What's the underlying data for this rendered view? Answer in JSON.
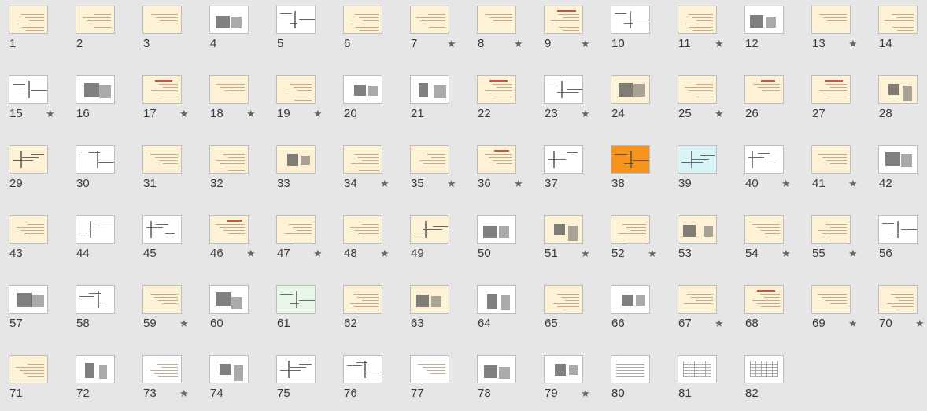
{
  "slides": [
    {
      "n": "1",
      "star": false,
      "bg": "cream",
      "kind": "text"
    },
    {
      "n": "2",
      "star": false,
      "bg": "cream",
      "kind": "text"
    },
    {
      "n": "3",
      "star": false,
      "bg": "cream",
      "kind": "text"
    },
    {
      "n": "4",
      "star": false,
      "bg": "white",
      "kind": "image"
    },
    {
      "n": "5",
      "star": false,
      "bg": "white",
      "kind": "diagram"
    },
    {
      "n": "6",
      "star": false,
      "bg": "cream",
      "kind": "text"
    },
    {
      "n": "7",
      "star": true,
      "bg": "cream",
      "kind": "text"
    },
    {
      "n": "8",
      "star": true,
      "bg": "cream",
      "kind": "text"
    },
    {
      "n": "9",
      "star": true,
      "bg": "cream",
      "kind": "title"
    },
    {
      "n": "10",
      "star": false,
      "bg": "white",
      "kind": "diagram"
    },
    {
      "n": "11",
      "star": true,
      "bg": "cream",
      "kind": "text"
    },
    {
      "n": "12",
      "star": false,
      "bg": "white",
      "kind": "image"
    },
    {
      "n": "13",
      "star": true,
      "bg": "cream",
      "kind": "text"
    },
    {
      "n": "14",
      "star": false,
      "bg": "cream",
      "kind": "text"
    },
    {
      "n": "15",
      "star": true,
      "bg": "white",
      "kind": "diagram"
    },
    {
      "n": "16",
      "star": false,
      "bg": "white",
      "kind": "image"
    },
    {
      "n": "17",
      "star": true,
      "bg": "cream",
      "kind": "title"
    },
    {
      "n": "18",
      "star": true,
      "bg": "cream",
      "kind": "text"
    },
    {
      "n": "19",
      "star": true,
      "bg": "cream",
      "kind": "text"
    },
    {
      "n": "20",
      "star": false,
      "bg": "white",
      "kind": "image"
    },
    {
      "n": "21",
      "star": false,
      "bg": "white",
      "kind": "image"
    },
    {
      "n": "22",
      "star": false,
      "bg": "cream",
      "kind": "title"
    },
    {
      "n": "23",
      "star": true,
      "bg": "white",
      "kind": "diagram"
    },
    {
      "n": "24",
      "star": false,
      "bg": "cream",
      "kind": "image"
    },
    {
      "n": "25",
      "star": true,
      "bg": "cream",
      "kind": "text"
    },
    {
      "n": "26",
      "star": false,
      "bg": "cream",
      "kind": "title"
    },
    {
      "n": "27",
      "star": false,
      "bg": "cream",
      "kind": "title"
    },
    {
      "n": "28",
      "star": false,
      "bg": "cream",
      "kind": "image"
    },
    {
      "n": "29",
      "star": false,
      "bg": "cream",
      "kind": "diagram"
    },
    {
      "n": "30",
      "star": false,
      "bg": "white",
      "kind": "diagram"
    },
    {
      "n": "31",
      "star": false,
      "bg": "cream",
      "kind": "text"
    },
    {
      "n": "32",
      "star": false,
      "bg": "cream",
      "kind": "text"
    },
    {
      "n": "33",
      "star": false,
      "bg": "cream",
      "kind": "image"
    },
    {
      "n": "34",
      "star": true,
      "bg": "cream",
      "kind": "text"
    },
    {
      "n": "35",
      "star": true,
      "bg": "cream",
      "kind": "text"
    },
    {
      "n": "36",
      "star": true,
      "bg": "cream",
      "kind": "title"
    },
    {
      "n": "37",
      "star": false,
      "bg": "white",
      "kind": "diagram"
    },
    {
      "n": "38",
      "star": false,
      "bg": "orange",
      "kind": "diagram"
    },
    {
      "n": "39",
      "star": false,
      "bg": "cyan",
      "kind": "diagram"
    },
    {
      "n": "40",
      "star": true,
      "bg": "white",
      "kind": "diagram"
    },
    {
      "n": "41",
      "star": true,
      "bg": "cream",
      "kind": "text"
    },
    {
      "n": "42",
      "star": false,
      "bg": "white",
      "kind": "image"
    },
    {
      "n": "43",
      "star": false,
      "bg": "cream",
      "kind": "text"
    },
    {
      "n": "44",
      "star": false,
      "bg": "white",
      "kind": "diagram"
    },
    {
      "n": "45",
      "star": false,
      "bg": "white",
      "kind": "diagram"
    },
    {
      "n": "46",
      "star": true,
      "bg": "cream",
      "kind": "title"
    },
    {
      "n": "47",
      "star": true,
      "bg": "cream",
      "kind": "text"
    },
    {
      "n": "48",
      "star": true,
      "bg": "cream",
      "kind": "text"
    },
    {
      "n": "49",
      "star": false,
      "bg": "cream",
      "kind": "diagram"
    },
    {
      "n": "50",
      "star": false,
      "bg": "white",
      "kind": "image"
    },
    {
      "n": "51",
      "star": true,
      "bg": "cream",
      "kind": "image"
    },
    {
      "n": "52",
      "star": true,
      "bg": "cream",
      "kind": "text"
    },
    {
      "n": "53",
      "star": false,
      "bg": "cream",
      "kind": "image"
    },
    {
      "n": "54",
      "star": true,
      "bg": "cream",
      "kind": "text"
    },
    {
      "n": "55",
      "star": true,
      "bg": "cream",
      "kind": "text"
    },
    {
      "n": "56",
      "star": false,
      "bg": "white",
      "kind": "diagram"
    },
    {
      "n": "57",
      "star": false,
      "bg": "white",
      "kind": "image"
    },
    {
      "n": "58",
      "star": false,
      "bg": "white",
      "kind": "diagram"
    },
    {
      "n": "59",
      "star": true,
      "bg": "cream",
      "kind": "text"
    },
    {
      "n": "60",
      "star": false,
      "bg": "white",
      "kind": "image"
    },
    {
      "n": "61",
      "star": false,
      "bg": "green",
      "kind": "diagram"
    },
    {
      "n": "62",
      "star": false,
      "bg": "cream",
      "kind": "text"
    },
    {
      "n": "63",
      "star": false,
      "bg": "cream",
      "kind": "image"
    },
    {
      "n": "64",
      "star": false,
      "bg": "white",
      "kind": "image"
    },
    {
      "n": "65",
      "star": false,
      "bg": "cream",
      "kind": "text"
    },
    {
      "n": "66",
      "star": false,
      "bg": "white",
      "kind": "image"
    },
    {
      "n": "67",
      "star": true,
      "bg": "cream",
      "kind": "text"
    },
    {
      "n": "68",
      "star": false,
      "bg": "cream",
      "kind": "title"
    },
    {
      "n": "69",
      "star": true,
      "bg": "cream",
      "kind": "text"
    },
    {
      "n": "70",
      "star": true,
      "bg": "cream",
      "kind": "text"
    },
    {
      "n": "71",
      "star": false,
      "bg": "cream",
      "kind": "text"
    },
    {
      "n": "72",
      "star": false,
      "bg": "white",
      "kind": "image"
    },
    {
      "n": "73",
      "star": true,
      "bg": "white",
      "kind": "text"
    },
    {
      "n": "74",
      "star": false,
      "bg": "white",
      "kind": "image"
    },
    {
      "n": "75",
      "star": false,
      "bg": "white",
      "kind": "diagram"
    },
    {
      "n": "76",
      "star": false,
      "bg": "white",
      "kind": "diagram"
    },
    {
      "n": "77",
      "star": false,
      "bg": "white",
      "kind": "text"
    },
    {
      "n": "78",
      "star": false,
      "bg": "white",
      "kind": "image"
    },
    {
      "n": "79",
      "star": true,
      "bg": "white",
      "kind": "image"
    },
    {
      "n": "80",
      "star": false,
      "bg": "white",
      "kind": "table"
    },
    {
      "n": "81",
      "star": false,
      "bg": "white",
      "kind": "chart"
    },
    {
      "n": "82",
      "star": false,
      "bg": "white",
      "kind": "chart"
    }
  ],
  "star_glyph": "★",
  "colors": {
    "background": "#e6e6e6",
    "slide_cream": "#fdf1d6",
    "number_text": "#3a3a3a"
  }
}
